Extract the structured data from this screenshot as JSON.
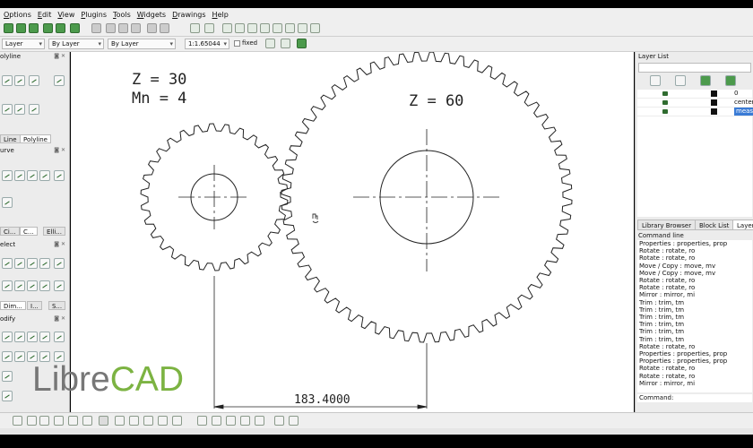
{
  "menu": [
    "Options",
    "Edit",
    "View",
    "Plugins",
    "Tools",
    "Widgets",
    "Drawings",
    "Help"
  ],
  "toolbar2": {
    "layer_combo": "Layer",
    "line_combo": "By Layer",
    "color_combo": "By Layer",
    "scale_value": "1:1.65044",
    "fixed_label": "fixed"
  },
  "left_panel": {
    "polyline_title": "olyline",
    "tab_line": "Line",
    "tab_polyline": "Polyline",
    "curve_title": "urve",
    "tabs_mid": [
      "Ci...",
      "C...",
      "Elli..."
    ],
    "select_title": "elect",
    "tabs_dim": [
      "Dim...",
      "I...",
      "S..."
    ],
    "modify_title": "odify"
  },
  "drawing": {
    "small_gear_teeth": "Z = 30",
    "module": "Mn = 4",
    "large_gear_teeth": "Z = 60",
    "dimension": "183.4000"
  },
  "layer_list": {
    "title": "Layer List",
    "layers": [
      {
        "name": "0",
        "selected": false
      },
      {
        "name": "center",
        "selected": false
      },
      {
        "name": "measu",
        "selected": true
      }
    ]
  },
  "right_tabs": [
    "Library Browser",
    "Block List",
    "Layer"
  ],
  "command_line": {
    "title": "Command line",
    "history": [
      "Properties : properties, prop",
      "Rotate : rotate, ro",
      "Rotate : rotate, ro",
      "Move / Copy : move, mv",
      "Move / Copy : move, mv",
      "Rotate : rotate, ro",
      "Rotate : rotate, ro",
      "Mirror : mirror, mi",
      "Trim : trim, tm",
      "Trim : trim, tm",
      "Trim : trim, tm",
      "Trim : trim, tm",
      "Trim : trim, tm",
      "Trim : trim, tm",
      "Rotate : rotate, ro",
      "Properties : properties, prop",
      "Properties : properties, prop",
      "Rotate : rotate, ro",
      "Rotate : rotate, ro",
      "Mirror : mirror, mi"
    ],
    "prompt": "Command:"
  },
  "logo": {
    "part1": "Libre",
    "part2": "CAD"
  },
  "colors": {
    "accent_green": "#2f6b2f",
    "logo_green": "#7cb342",
    "selection": "#3a7bd5"
  }
}
